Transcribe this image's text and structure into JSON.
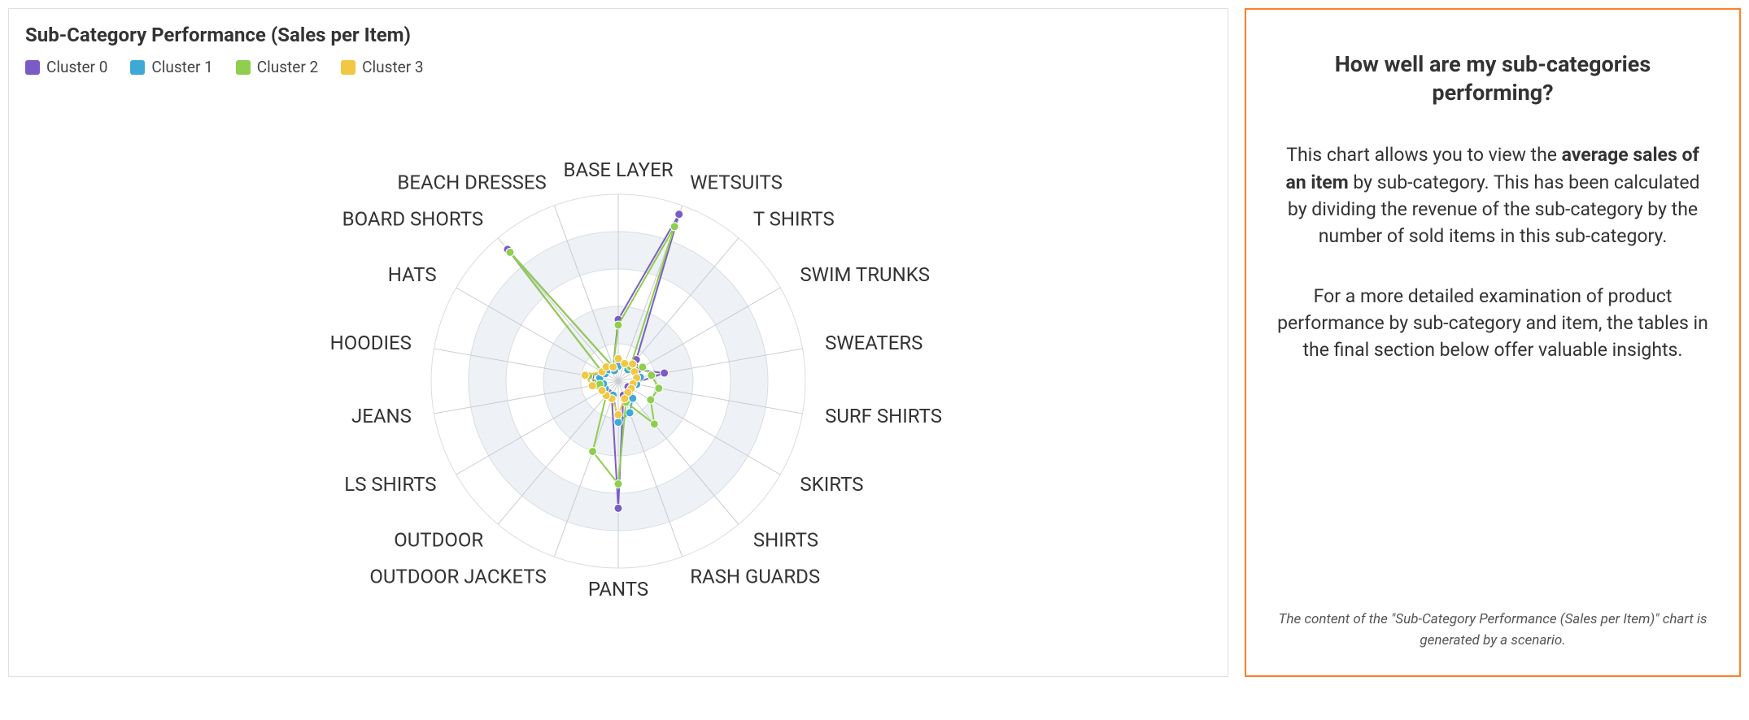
{
  "chart": {
    "title": "Sub-Category Performance (Sales per Item)",
    "legend": [
      {
        "label": "Cluster 0",
        "color": "#7b5cc7"
      },
      {
        "label": "Cluster 1",
        "color": "#3fa9d6"
      },
      {
        "label": "Cluster 2",
        "color": "#8fce4e"
      },
      {
        "label": "Cluster 3",
        "color": "#f2c744"
      }
    ]
  },
  "info": {
    "title": "How well are my sub-categories performing?",
    "para1_prefix": "This chart allows you to view the ",
    "para1_bold": "average sales of an item",
    "para1_suffix": " by sub-category. This has been calculated by dividing the revenue of the sub-category by the number of sold items in this sub-category.",
    "para2": "For a more detailed examination of product performance by sub-category and item, the tables in the final section below offer valuable insights.",
    "note": "The content of the \"Sub-Category Performance (Sales per Item)\" chart is generated by a scenario."
  },
  "chart_data": {
    "type": "radar",
    "title": "Sub-Category Performance (Sales per Item)",
    "categories": [
      "BASE LAYER",
      "WETSUITS",
      "T SHIRTS",
      "SWIM TRUNKS",
      "SWEATERS",
      "SURF SHIRTS",
      "SKIRTS",
      "SHIRTS",
      "RASH GUARDS",
      "PANTS",
      "OUTDOOR JACKETS",
      "OUTDOOR",
      "LS SHIRTS",
      "JEANS",
      "HOODIES",
      "HATS",
      "BOARD SHORTS",
      "BEACH DRESSES"
    ],
    "rlim": [
      0,
      100
    ],
    "gridlines": [
      20,
      40,
      60,
      80,
      100
    ],
    "series": [
      {
        "name": "Cluster 0",
        "color": "#7b5cc7",
        "values": [
          33,
          95,
          15,
          12,
          25,
          8,
          6,
          8,
          8,
          68,
          10,
          8,
          10,
          12,
          15,
          10,
          92,
          8
        ]
      },
      {
        "name": "Cluster 1",
        "color": "#3fa9d6",
        "values": [
          8,
          10,
          8,
          10,
          12,
          10,
          8,
          12,
          18,
          22,
          8,
          10,
          8,
          8,
          10,
          8,
          8,
          6
        ]
      },
      {
        "name": "Cluster 2",
        "color": "#8fce4e",
        "values": [
          30,
          88,
          10,
          15,
          18,
          22,
          20,
          30,
          12,
          55,
          40,
          10,
          10,
          10,
          16,
          10,
          90,
          8
        ]
      },
      {
        "name": "Cluster 3",
        "color": "#f2c744",
        "values": [
          12,
          10,
          12,
          10,
          10,
          8,
          8,
          8,
          10,
          18,
          10,
          10,
          10,
          14,
          18,
          10,
          10,
          8
        ]
      }
    ]
  }
}
